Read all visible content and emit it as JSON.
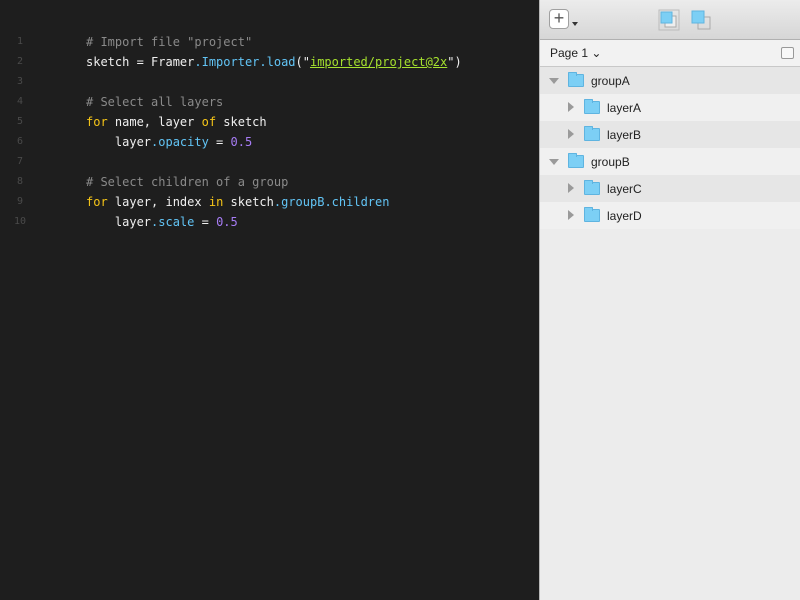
{
  "editor": {
    "lines": [
      {
        "n": "1",
        "parts": [
          [
            "cm",
            "# Import file \"project\""
          ]
        ]
      },
      {
        "n": "2",
        "parts": [
          [
            "",
            "sketch = Framer"
          ],
          [
            "pr",
            ".Importer.load"
          ],
          [
            "",
            "(\""
          ],
          [
            "st",
            "imported/project@2x"
          ],
          [
            "",
            "\")"
          ]
        ]
      },
      {
        "n": "3",
        "parts": []
      },
      {
        "n": "4",
        "parts": [
          [
            "cm",
            "# Select all layers"
          ]
        ]
      },
      {
        "n": "5",
        "parts": [
          [
            "kw",
            "for"
          ],
          [
            "",
            " name, layer "
          ],
          [
            "kw",
            "of"
          ],
          [
            "",
            " sketch"
          ]
        ]
      },
      {
        "n": "6",
        "parts": [
          [
            "",
            "    layer"
          ],
          [
            "pr",
            ".opacity"
          ],
          [
            "",
            " = "
          ],
          [
            "nm",
            "0.5"
          ]
        ]
      },
      {
        "n": "7",
        "parts": []
      },
      {
        "n": "8",
        "parts": [
          [
            "cm",
            "# Select children of a group"
          ]
        ]
      },
      {
        "n": "9",
        "parts": [
          [
            "kw",
            "for"
          ],
          [
            "",
            " layer, index "
          ],
          [
            "kw",
            "in"
          ],
          [
            "",
            " sketch"
          ],
          [
            "pr",
            ".groupB.children"
          ]
        ]
      },
      {
        "n": "10",
        "parts": [
          [
            "",
            "    layer"
          ],
          [
            "pr",
            ".scale"
          ],
          [
            "",
            " = "
          ],
          [
            "nm",
            "0.5"
          ]
        ]
      }
    ]
  },
  "panel": {
    "add_label": "+",
    "page_selector": "Page 1 ⌄",
    "layers": [
      {
        "name": "groupA",
        "level": 0,
        "expanded": true
      },
      {
        "name": "layerA",
        "level": 1,
        "expanded": false
      },
      {
        "name": "layerB",
        "level": 1,
        "expanded": false
      },
      {
        "name": "groupB",
        "level": 0,
        "expanded": true
      },
      {
        "name": "layerC",
        "level": 1,
        "expanded": false
      },
      {
        "name": "layerD",
        "level": 1,
        "expanded": false
      }
    ]
  }
}
